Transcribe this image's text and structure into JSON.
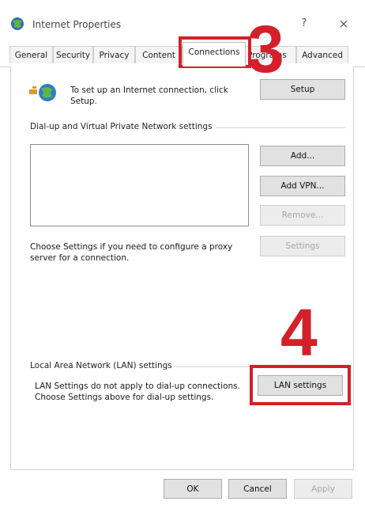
{
  "window": {
    "title": "Internet Properties",
    "help_label": "?",
    "close_label": "×",
    "icon": "internet-options-globe-icon"
  },
  "tabs": [
    {
      "label": "General"
    },
    {
      "label": "Security"
    },
    {
      "label": "Privacy"
    },
    {
      "label": "Content"
    },
    {
      "label": "Connections",
      "active": true
    },
    {
      "label": "Programs"
    },
    {
      "label": "Advanced"
    }
  ],
  "connections": {
    "setup_text": "To set up an Internet connection, click Setup.",
    "setup_button": "Setup",
    "dialup_group_label": "Dial-up and Virtual Private Network settings",
    "add_button": "Add...",
    "add_vpn_button": "Add VPN...",
    "remove_button": "Remove...",
    "proxy_text": "Choose Settings if you need to configure a proxy server for a connection.",
    "settings_button": "Settings",
    "lan_group_label": "Local Area Network (LAN) settings",
    "lan_text": "LAN Settings do not apply to dial-up connections. Choose Settings above for dial-up settings.",
    "lan_settings_button": "LAN settings"
  },
  "footer": {
    "ok_button": "OK",
    "cancel_button": "Cancel",
    "apply_button": "Apply"
  },
  "annotations": {
    "step3": "3",
    "step4": "4",
    "color": "#d3202a"
  }
}
